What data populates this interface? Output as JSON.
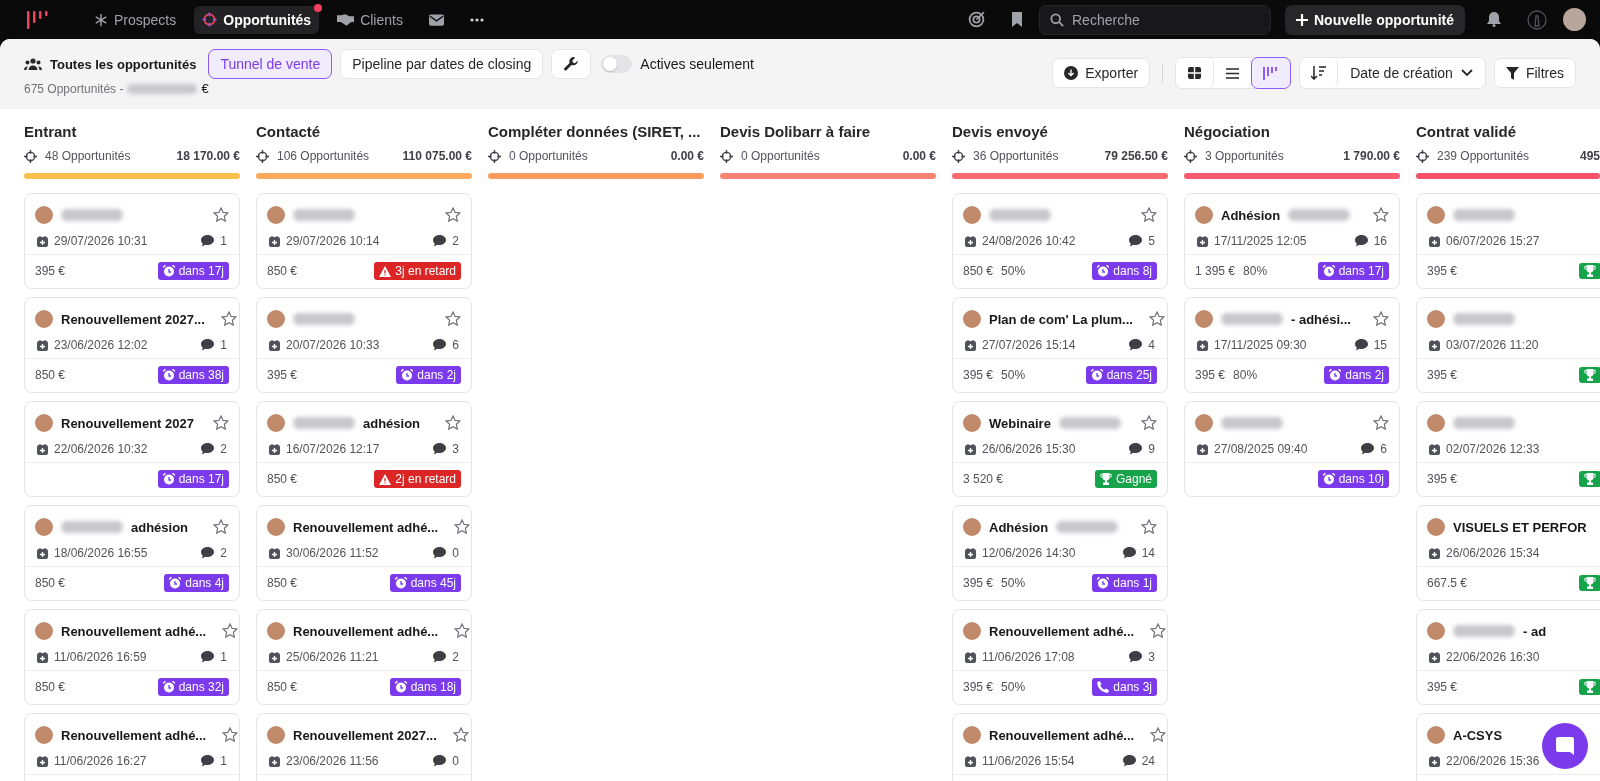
{
  "nav": {
    "items": [
      {
        "kind": "snowflake",
        "label": "Prospects",
        "selected": false,
        "notification": false
      },
      {
        "kind": "target",
        "label": "Opportunités",
        "selected": true,
        "notification": true
      },
      {
        "kind": "handshake",
        "label": "Clients",
        "selected": false,
        "notification": false
      },
      {
        "kind": "mail",
        "selected": false,
        "notification": false
      },
      {
        "kind": "more",
        "selected": false,
        "notification": false
      }
    ],
    "search": {
      "placeholder": "Recherche"
    },
    "new_button": "Nouvelle opportunité"
  },
  "toolbar": {
    "title": "Toutes les opportunités",
    "tabs": [
      {
        "label": "Tunnel de vente",
        "selected": true
      },
      {
        "label": "Pipeline par dates de closing",
        "selected": false
      }
    ],
    "toggle": {
      "label": "Actives seulement",
      "on": false
    },
    "summary": {
      "count": "675 Opportunités -",
      "currency": "€"
    },
    "export": "Exporter",
    "view_modes": [
      {
        "kind": "grid",
        "selected": false
      },
      {
        "kind": "list",
        "selected": false
      },
      {
        "kind": "kanban",
        "selected": true
      }
    ],
    "sort": "Date de création",
    "filters": "Filtres"
  },
  "columns": [
    {
      "title": "Entrant",
      "count": "48 Opportunités",
      "total": "18 170.00 €",
      "color": "#fbbf4e",
      "clipped": false,
      "cards": [
        {
          "kind": "redacted",
          "date": "29/07/2026 10:31",
          "comments": "1",
          "amount": "395 €",
          "badge": {
            "kind": "reminder",
            "text": "dans 17j"
          }
        },
        {
          "kind": "titled",
          "title": "Renouvellement 2027...",
          "date": "23/06/2026 12:02",
          "comments": "1",
          "amount": "850 €",
          "badge": {
            "kind": "reminder",
            "text": "dans 38j"
          }
        },
        {
          "kind": "titled",
          "title": "Renouvellement 2027",
          "date": "22/06/2026 10:32",
          "comments": "2",
          "badge": {
            "kind": "reminder",
            "text": "dans 17j"
          }
        },
        {
          "kind": "redacted_prefix",
          "title": "adhésion",
          "date": "18/06/2026 16:55",
          "comments": "2",
          "amount": "850 €",
          "badge": {
            "kind": "reminder",
            "text": "dans 4j"
          }
        },
        {
          "kind": "titled",
          "title": "Renouvellement adhé...",
          "date": "11/06/2026 16:59",
          "comments": "1",
          "amount": "850 €",
          "badge": {
            "kind": "reminder",
            "text": "dans 32j"
          }
        },
        {
          "kind": "titled",
          "title": "Renouvellement adhé...",
          "date": "11/06/2026 16:27",
          "comments": "1"
        }
      ]
    },
    {
      "title": "Contacté",
      "count": "106 Opportunités",
      "total": "110 075.00 €",
      "color": "#fdaa5c",
      "clipped": false,
      "cards": [
        {
          "kind": "redacted",
          "date": "29/07/2026 10:14",
          "comments": "2",
          "amount": "850 €",
          "badge": {
            "kind": "late",
            "text": "3j en retard"
          }
        },
        {
          "kind": "redacted",
          "date": "20/07/2026 10:33",
          "comments": "6",
          "amount": "395 €",
          "badge": {
            "kind": "reminder",
            "text": "dans 2j"
          }
        },
        {
          "kind": "redacted_prefix",
          "title": "adhésion",
          "date": "16/07/2026 12:17",
          "comments": "3",
          "amount": "850 €",
          "badge": {
            "kind": "late",
            "text": "2j en retard"
          }
        },
        {
          "kind": "titled",
          "title": "Renouvellement adhé...",
          "date": "30/06/2026 11:52",
          "comments": "0",
          "amount": "850 €",
          "badge": {
            "kind": "reminder",
            "text": "dans 45j"
          }
        },
        {
          "kind": "titled",
          "title": "Renouvellement adhé...",
          "date": "25/06/2026 11:21",
          "comments": "2",
          "amount": "850 €",
          "badge": {
            "kind": "reminder",
            "text": "dans 18j"
          }
        },
        {
          "kind": "titled",
          "title": "Renouvellement 2027...",
          "date": "23/06/2026 11:56",
          "comments": "0"
        }
      ]
    },
    {
      "title": "Compléter données (SIRET, ...",
      "count": "0 Opportunités",
      "total": "0.00 €",
      "color": "#fd9a5c",
      "clipped": false
    },
    {
      "title": "Devis Dolibarr à faire",
      "count": "0 Opportunités",
      "total": "0.00 €",
      "color": "#fb8272",
      "clipped": false
    },
    {
      "title": "Devis envoyé",
      "count": "36 Opportunités",
      "total": "79 256.50 €",
      "color": "#fb6b70",
      "clipped": false,
      "cards": [
        {
          "kind": "redacted",
          "date": "24/08/2026 10:42",
          "comments": "5",
          "amount": "850 €",
          "percent": "50%",
          "badge": {
            "kind": "reminder",
            "text": "dans 8j"
          }
        },
        {
          "kind": "titled",
          "title": "Plan de com' La plum...",
          "date": "27/07/2026 15:14",
          "comments": "4",
          "amount": "395 €",
          "percent": "50%",
          "badge": {
            "kind": "reminder",
            "text": "dans 25j"
          }
        },
        {
          "kind": "redacted_suffix",
          "title": "Webinaire",
          "date": "26/06/2026 15:30",
          "comments": "9",
          "amount": "3 520 €",
          "badge": {
            "kind": "won",
            "text": "Gagné"
          }
        },
        {
          "kind": "redacted_suffix",
          "title": "Adhésion",
          "date": "12/06/2026 14:30",
          "comments": "14",
          "amount": "395 €",
          "percent": "50%",
          "badge": {
            "kind": "reminder",
            "text": "dans 1j"
          }
        },
        {
          "kind": "titled",
          "title": "Renouvellement adhé...",
          "date": "11/06/2026 17:08",
          "comments": "3",
          "amount": "395 €",
          "percent": "50%",
          "badge": {
            "kind": "call",
            "text": "dans 3j"
          }
        },
        {
          "kind": "titled",
          "title": "Renouvellement adhé...",
          "date": "11/06/2026 15:54",
          "comments": "24"
        }
      ]
    },
    {
      "title": "Négociation",
      "count": "3 Opportunités",
      "total": "1 790.00 €",
      "color": "#f95a6e",
      "clipped": false,
      "cards": [
        {
          "kind": "redacted_suffix",
          "title": "Adhésion",
          "date": "17/11/2025 12:05",
          "comments": "16",
          "amount": "1 395 €",
          "percent": "80%",
          "badge": {
            "kind": "reminder",
            "text": "dans 17j"
          }
        },
        {
          "kind": "redacted_prefix",
          "title": "- adhési...",
          "date": "17/11/2025 09:30",
          "comments": "15",
          "amount": "395 €",
          "percent": "80%",
          "badge": {
            "kind": "reminder",
            "text": "dans 2j"
          }
        },
        {
          "kind": "redacted",
          "date": "27/08/2025 09:40",
          "comments": "6",
          "badge": {
            "kind": "reminder",
            "text": "dans 10j"
          }
        }
      ]
    },
    {
      "title": "Contrat validé",
      "count": "239 Opportunités",
      "total": "495",
      "color": "#f7506a",
      "clipped": true,
      "cards": [
        {
          "kind": "redacted",
          "date": "06/07/2026 15:27",
          "amount": "395 €",
          "badge": {
            "kind": "won"
          }
        },
        {
          "kind": "redacted",
          "date": "03/07/2026 11:20",
          "amount": "395 €",
          "badge": {
            "kind": "won"
          }
        },
        {
          "kind": "redacted",
          "date": "02/07/2026 12:33",
          "amount": "395 €",
          "badge": {
            "kind": "won"
          }
        },
        {
          "kind": "titled",
          "title": "VISUELS ET PERFOR",
          "date": "26/06/2026 15:34",
          "amount": "667.5 €",
          "badge": {
            "kind": "won"
          }
        },
        {
          "kind": "redacted_prefix",
          "title": "- ad",
          "date": "22/06/2026 16:30",
          "amount": "395 €",
          "badge": {
            "kind": "won"
          }
        },
        {
          "kind": "titled",
          "title": "A-CSYS",
          "date": "22/06/2026 15:36"
        }
      ]
    }
  ]
}
